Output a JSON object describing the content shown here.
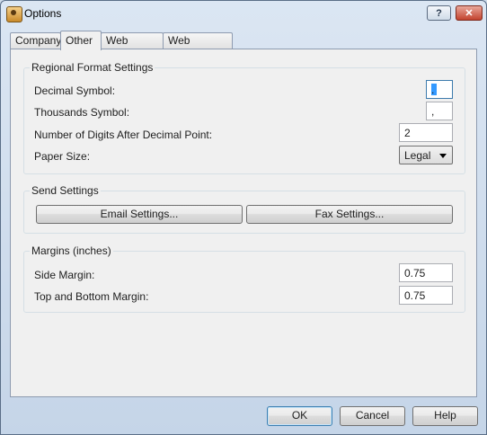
{
  "window": {
    "title": "Options"
  },
  "tabs": [
    {
      "label": "Company"
    },
    {
      "label": "Other"
    },
    {
      "label": "Web Access"
    },
    {
      "label": "Web Accounts"
    }
  ],
  "regional": {
    "title": "Regional Format Settings",
    "decimal_symbol": {
      "label": "Decimal Symbol:",
      "value": "."
    },
    "thousands_symbol": {
      "label": "Thousands Symbol:",
      "value": ","
    },
    "digits": {
      "label": "Number of Digits After Decimal Point:",
      "value": "2"
    },
    "paper_size": {
      "label": "Paper Size:",
      "value": "Legal"
    }
  },
  "send": {
    "title": "Send Settings",
    "email_button": "Email Settings...",
    "fax_button": "Fax Settings..."
  },
  "margins": {
    "title": "Margins (inches)",
    "side": {
      "label": "Side Margin:",
      "value": "0.75"
    },
    "top_bottom": {
      "label": "Top and Bottom Margin:",
      "value": "0.75"
    }
  },
  "footer": {
    "ok": "OK",
    "cancel": "Cancel",
    "help": "Help"
  },
  "icons": {
    "help_caption": "?",
    "close_caption": "✕"
  }
}
